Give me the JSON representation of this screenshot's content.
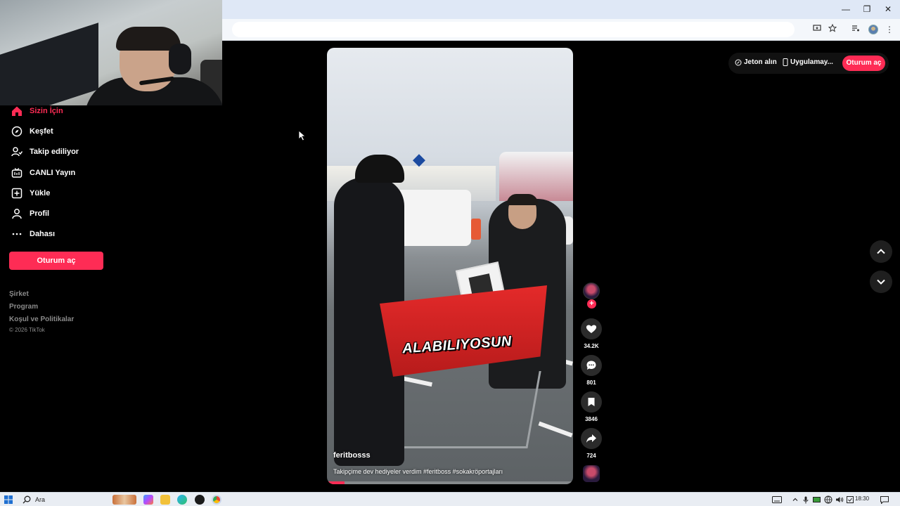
{
  "browser": {
    "window_controls": {
      "minimize": "—",
      "restore": "❐",
      "close": "✕"
    }
  },
  "sidebar": {
    "items": [
      {
        "label": "Sizin İçin",
        "icon": "home-icon",
        "active": true
      },
      {
        "label": "Keşfet",
        "icon": "compass-icon"
      },
      {
        "label": "Takip ediliyor",
        "icon": "following-icon"
      },
      {
        "label": "CANLI Yayın",
        "icon": "live-icon"
      },
      {
        "label": "Yükle",
        "icon": "upload-icon"
      },
      {
        "label": "Profil",
        "icon": "profile-icon"
      },
      {
        "label": "Dahası",
        "icon": "more-icon"
      }
    ],
    "login_label": "Oturum aç",
    "footer_links": [
      "Şirket",
      "Program",
      "Koşul ve Politikalar"
    ],
    "copyright": "© 2026 TikTok"
  },
  "header_pill": {
    "coins_label": "Jeton alın",
    "app_label": "Uygulamay...",
    "login_label": "Oturum aç"
  },
  "video": {
    "overlay_text": "ALABILIYOSUN",
    "author": "feritbosss",
    "description": "Takipçime dev hediyeler verdim #feritboss #sokakröportajları",
    "progress": 0.07
  },
  "actions": {
    "likes": "34.2K",
    "comments": "801",
    "saves": "3846",
    "shares": "724"
  },
  "taskbar": {
    "search_placeholder": "Ara",
    "time": "18:30"
  },
  "colors": {
    "accent": "#fe2c55",
    "background": "#000000"
  }
}
